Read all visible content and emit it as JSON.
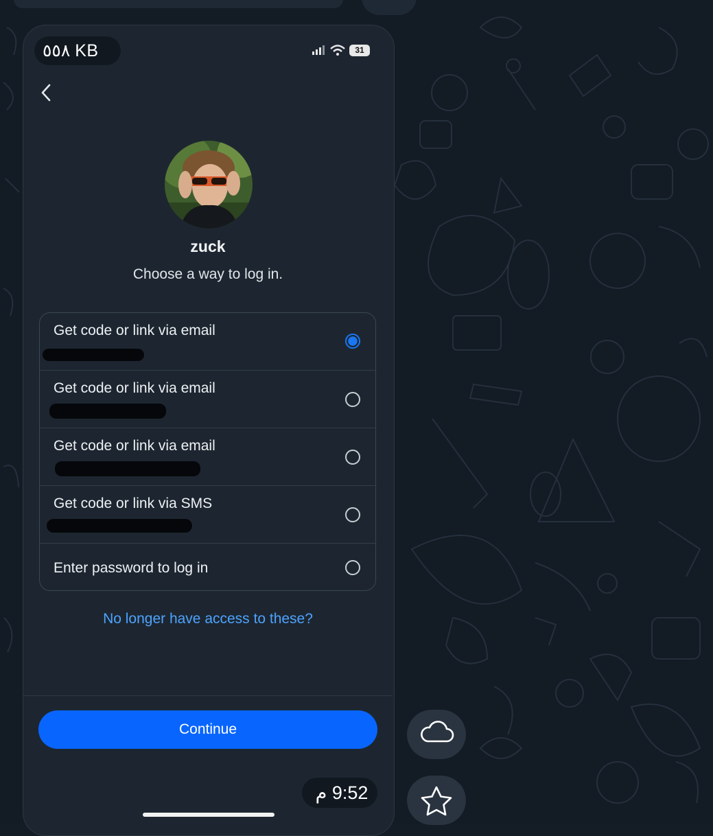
{
  "status_bar": {
    "left_text": "٥٥٨ KB",
    "battery": "31"
  },
  "profile": {
    "username": "zuck",
    "subtitle": "Choose a way to log in."
  },
  "options": [
    {
      "label": "Get code or link via email",
      "selected": true
    },
    {
      "label": "Get code or link via email",
      "selected": false
    },
    {
      "label": "Get code or link via email",
      "selected": false
    },
    {
      "label": "Get code or link via SMS",
      "selected": false
    },
    {
      "label": "Enter password to log in",
      "selected": false
    }
  ],
  "links": {
    "no_access": "No longer have access to these?"
  },
  "actions": {
    "continue": "Continue"
  },
  "message": {
    "time": "9:52 م"
  },
  "colors": {
    "accent": "#0866ff",
    "link": "#4da3ff",
    "background": "#131b25"
  }
}
